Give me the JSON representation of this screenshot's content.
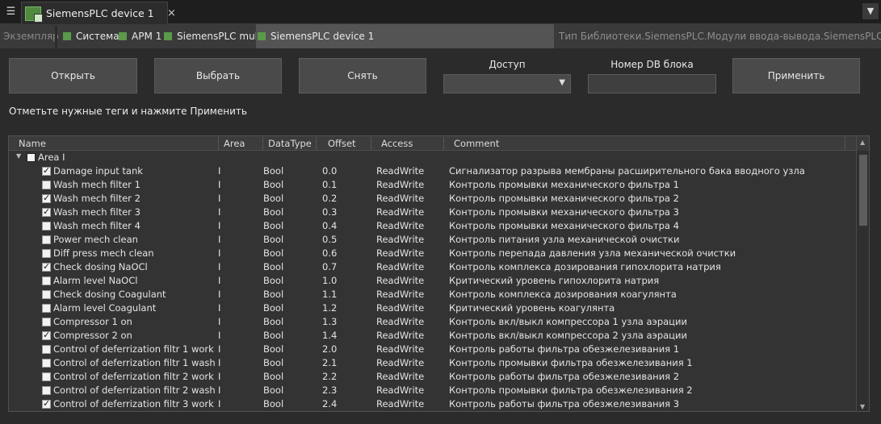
{
  "tabs": {
    "document_title": "SiemensPLC device 1",
    "close_glyph": "×"
  },
  "breadcrumb": {
    "label": "Экземпляр",
    "items": [
      {
        "label": "Система"
      },
      {
        "label": "АРМ 1"
      },
      {
        "label": "SiemensPLC multi"
      },
      {
        "label": "SiemensPLC device 1"
      }
    ],
    "type_path": "Тип Библиотеки.SiemensPLC.Модули ввода-вывода.SiemensPLC device"
  },
  "toolbar": {
    "open_label": "Открыть",
    "select_label": "Выбрать",
    "deselect_label": "Снять",
    "access_label": "Доступ",
    "access_value": "",
    "db_number_label": "Номер DB блока",
    "db_number_value": "",
    "apply_label": "Применить"
  },
  "hint": "Отметьте нужные теги и нажмите Применить",
  "table": {
    "columns": [
      "Name",
      "Area",
      "DataType",
      "Offset",
      "Access",
      "Comment"
    ],
    "group": {
      "label": "Area I",
      "checked": false
    },
    "rows": [
      {
        "name": "Damage input tank",
        "area": "I",
        "type": "Bool",
        "offset": "0.0",
        "access": "ReadWrite",
        "comment": "Сигнализатор разрыва мембраны расширительного бака вводного узла",
        "checked": true
      },
      {
        "name": "Wash mech filter 1",
        "area": "I",
        "type": "Bool",
        "offset": "0.1",
        "access": "ReadWrite",
        "comment": "Контроль промывки механического фильтра 1",
        "checked": false
      },
      {
        "name": "Wash mech filter 2",
        "area": "I",
        "type": "Bool",
        "offset": "0.2",
        "access": "ReadWrite",
        "comment": "Контроль промывки механического фильтра 2",
        "checked": true
      },
      {
        "name": "Wash mech filter 3",
        "area": "I",
        "type": "Bool",
        "offset": "0.3",
        "access": "ReadWrite",
        "comment": "Контроль промывки механического фильтра 3",
        "checked": true
      },
      {
        "name": "Wash mech filter 4",
        "area": "I",
        "type": "Bool",
        "offset": "0.4",
        "access": "ReadWrite",
        "comment": "Контроль промывки механического фильтра 4",
        "checked": false
      },
      {
        "name": "Power mech clean",
        "area": "I",
        "type": "Bool",
        "offset": "0.5",
        "access": "ReadWrite",
        "comment": "Контроль питания узла механической очистки",
        "checked": false
      },
      {
        "name": "Diff press mech clean",
        "area": "I",
        "type": "Bool",
        "offset": "0.6",
        "access": "ReadWrite",
        "comment": "Контроль перепада давления узла механической очистки",
        "checked": false
      },
      {
        "name": "Check dosing NaOCl",
        "area": "I",
        "type": "Bool",
        "offset": "0.7",
        "access": "ReadWrite",
        "comment": "Контроль комплекса дозирования гипохлорита натрия",
        "checked": true
      },
      {
        "name": "Alarm level NaOCl",
        "area": "I",
        "type": "Bool",
        "offset": "1.0",
        "access": "ReadWrite",
        "comment": "Критический уровень гипохлорита натрия",
        "checked": false
      },
      {
        "name": "Check dosing Coagulant",
        "area": "I",
        "type": "Bool",
        "offset": "1.1",
        "access": "ReadWrite",
        "comment": "Контроль комплекса дозирования коагулянта",
        "checked": false
      },
      {
        "name": "Alarm level Coagulant",
        "area": "I",
        "type": "Bool",
        "offset": "1.2",
        "access": "ReadWrite",
        "comment": "Критический уровень коагулянта",
        "checked": false
      },
      {
        "name": "Compressor 1 on",
        "area": "I",
        "type": "Bool",
        "offset": "1.3",
        "access": "ReadWrite",
        "comment": "Контроль вкл/выкл компрессора 1 узла аэрации",
        "checked": false
      },
      {
        "name": "Compressor 2 on",
        "area": "I",
        "type": "Bool",
        "offset": "1.4",
        "access": "ReadWrite",
        "comment": "Контроль вкл/выкл компрессора 2 узла аэрации",
        "checked": true
      },
      {
        "name": "Control of deferrization filtr 1 work",
        "area": "I",
        "type": "Bool",
        "offset": "2.0",
        "access": "ReadWrite",
        "comment": "Контроль работы фильтра обезжелезивания 1",
        "checked": false
      },
      {
        "name": "Control of deferrization filtr 1 wash",
        "area": "I",
        "type": "Bool",
        "offset": "2.1",
        "access": "ReadWrite",
        "comment": "Контроль промывки фильтра обезжелезивания 1",
        "checked": false
      },
      {
        "name": "Control of deferrization filtr 2 work",
        "area": "I",
        "type": "Bool",
        "offset": "2.2",
        "access": "ReadWrite",
        "comment": "Контроль работы фильтра обезжелезивания 2",
        "checked": false
      },
      {
        "name": "Control of deferrization filtr 2 wash",
        "area": "I",
        "type": "Bool",
        "offset": "2.3",
        "access": "ReadWrite",
        "comment": "Контроль промывки фильтра обезжелезивания 2",
        "checked": false
      },
      {
        "name": "Control of deferrization filtr 3 work",
        "area": "I",
        "type": "Bool",
        "offset": "2.4",
        "access": "ReadWrite",
        "comment": "Контроль работы фильтра обезжелезивания 3",
        "checked": true
      }
    ]
  },
  "icons": {
    "panel_menu": "list-collapse-icon",
    "app": "plc-device-icon",
    "overflow": "chevron-down-icon"
  },
  "colors": {
    "breadcrumb_marker": "#5a9a4a",
    "background": "#2b2b2b",
    "button": "#4a4a4a"
  }
}
